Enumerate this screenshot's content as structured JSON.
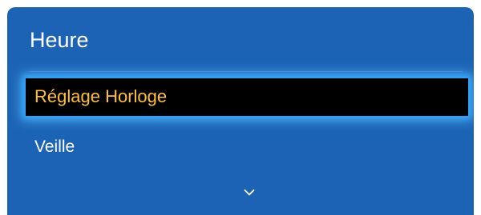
{
  "menu": {
    "title": "Heure",
    "items": [
      {
        "label": "Réglage Horloge",
        "selected": true
      },
      {
        "label": "Veille",
        "selected": false
      }
    ],
    "more_indicator_icon": "chevron-down-icon"
  },
  "colors": {
    "panel_bg": "#1c63b5",
    "selected_bg": "#000000",
    "selected_text": "#ffc22b",
    "selected_glow": "#2ba6ff",
    "text": "#ffffff"
  }
}
